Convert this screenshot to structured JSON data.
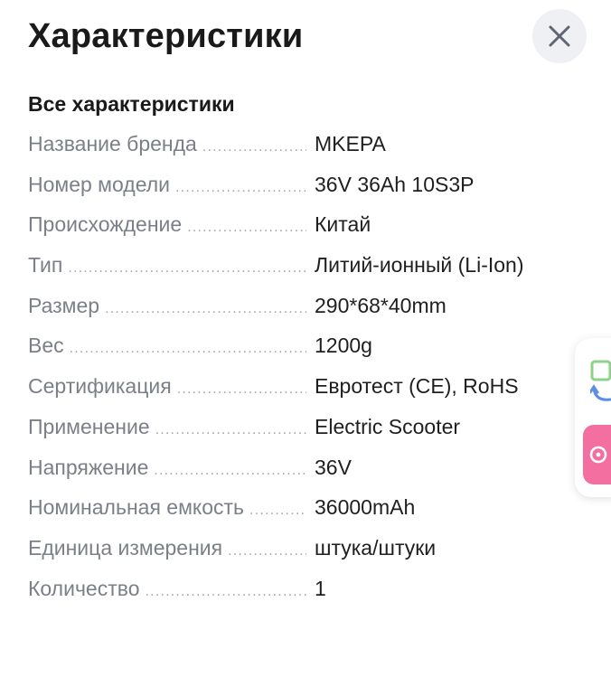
{
  "header": {
    "title": "Характеристики",
    "close_icon": "close-icon"
  },
  "section": {
    "title": "Все характеристики"
  },
  "specs": [
    {
      "key": "Название бренда",
      "value": "MKEPA"
    },
    {
      "key": "Номер модели",
      "value": "36V 36Ah 10S3P"
    },
    {
      "key": "Происхождение",
      "value": "Китай"
    },
    {
      "key": "Тип",
      "value": "Литий-ионный (Li-Ion)"
    },
    {
      "key": "Размер",
      "value": "290*68*40mm"
    },
    {
      "key": "Вес",
      "value": "1200g"
    },
    {
      "key": "Сертификация",
      "value": "Евротест (CE), RoHS"
    },
    {
      "key": "Применение",
      "value": "Electric Scooter"
    },
    {
      "key": "Напряжение",
      "value": "36V"
    },
    {
      "key": "Номинальная емкость",
      "value": "36000mAh"
    },
    {
      "key": "Единица измерения",
      "value": "штука/штуки"
    },
    {
      "key": "Количество",
      "value": "1"
    }
  ],
  "side_widget": {
    "icons": [
      "translate-icon",
      "chat-icon"
    ],
    "accent_color": "#f26fa0"
  },
  "colors": {
    "label": "#7b7f87",
    "value": "#1f1f1f",
    "close_bg": "#eef0f4"
  }
}
